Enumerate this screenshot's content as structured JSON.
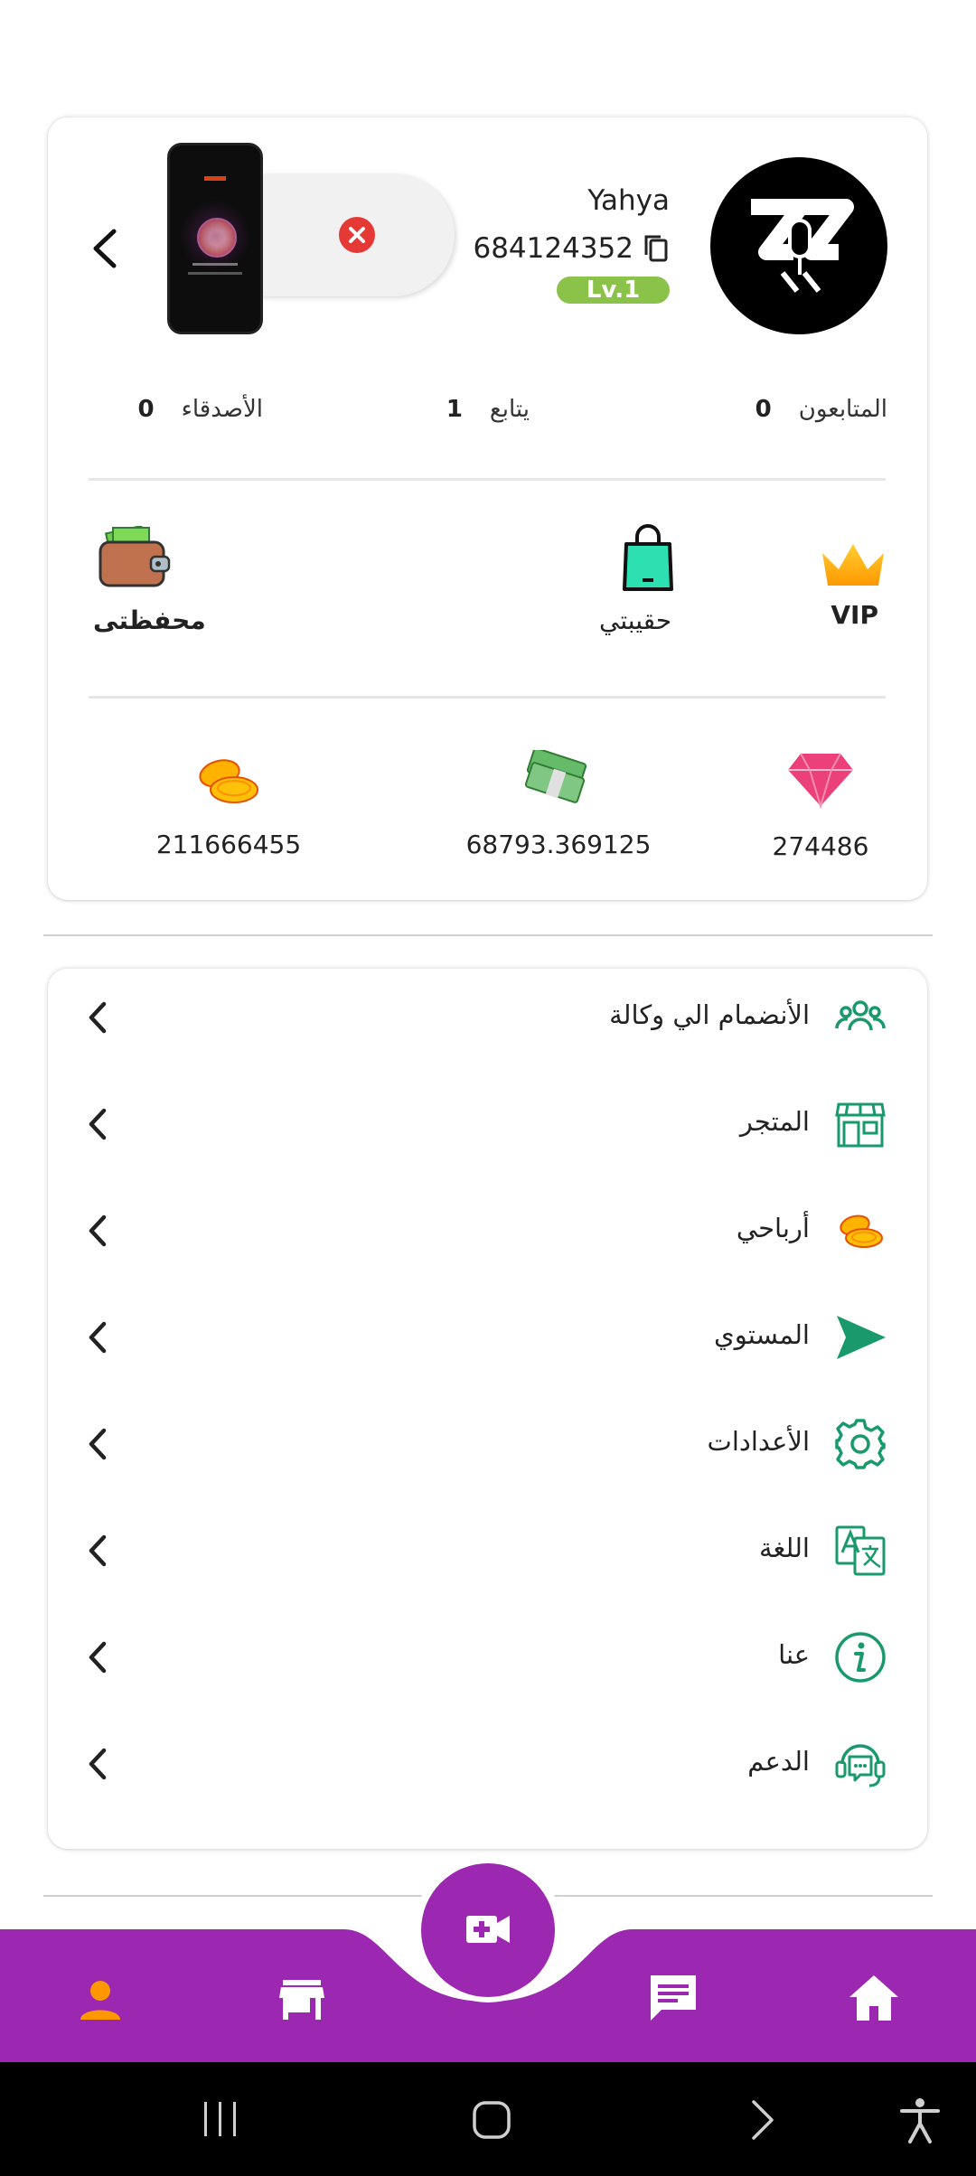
{
  "profile": {
    "username": "Yahya",
    "user_id": "684124352",
    "level": "Lv.1",
    "stats": [
      {
        "label": "المتابعون",
        "value": "0"
      },
      {
        "label": "يتابع",
        "value": "1"
      },
      {
        "label": "الأصدقاء",
        "value": "0"
      }
    ]
  },
  "quick_actions": {
    "vip": "VIP",
    "bag": "حقيبتي",
    "wallet": "محفظتى"
  },
  "balances": {
    "diamonds": "274486",
    "cash": "68793.369125",
    "coins": "211666455"
  },
  "menu": [
    {
      "label": "الأنضمام الي وكالة",
      "icon": "people-icon"
    },
    {
      "label": "المتجر",
      "icon": "store-icon"
    },
    {
      "label": "أرباحي",
      "icon": "coins-icon"
    },
    {
      "label": "المستوي",
      "icon": "send-icon"
    },
    {
      "label": "الأعدادات",
      "icon": "gear-icon"
    },
    {
      "label": "اللغة",
      "icon": "translate-icon"
    },
    {
      "label": "عنا",
      "icon": "info-icon"
    },
    {
      "label": "الدعم",
      "icon": "support-icon"
    }
  ],
  "colors": {
    "accent_purple": "#9c27b0",
    "accent_orange": "#ff9800",
    "icon_green": "#1a9a6c",
    "level_green": "#8bc34a"
  },
  "bottom_nav": [
    "profile-icon",
    "store-icon",
    "live-video-icon",
    "chat-icon",
    "home-icon"
  ]
}
